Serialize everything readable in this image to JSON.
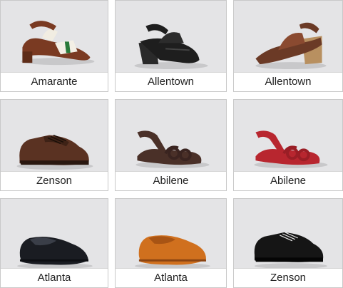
{
  "products": [
    {
      "name": "Amarante",
      "icon": "sandal-icon",
      "color": "#7a3a22"
    },
    {
      "name": "Allentown",
      "icon": "wedge-sandal-icon",
      "color": "#1e1e1e"
    },
    {
      "name": "Allentown",
      "icon": "wedge-sandal-icon",
      "color": "#6b3a26"
    },
    {
      "name": "Zenson",
      "icon": "lace-up-shoe-icon",
      "color": "#5a3222"
    },
    {
      "name": "Abilene",
      "icon": "t-strap-sandal-icon",
      "color": "#4a3028"
    },
    {
      "name": "Abilene",
      "icon": "t-strap-sandal-icon",
      "color": "#b8262f"
    },
    {
      "name": "Atlanta",
      "icon": "loafer-icon",
      "color": "#1a1c22"
    },
    {
      "name": "Atlanta",
      "icon": "loafer-icon",
      "color": "#d0701e"
    },
    {
      "name": "Zenson",
      "icon": "lace-up-shoe-icon",
      "color": "#151515"
    }
  ]
}
